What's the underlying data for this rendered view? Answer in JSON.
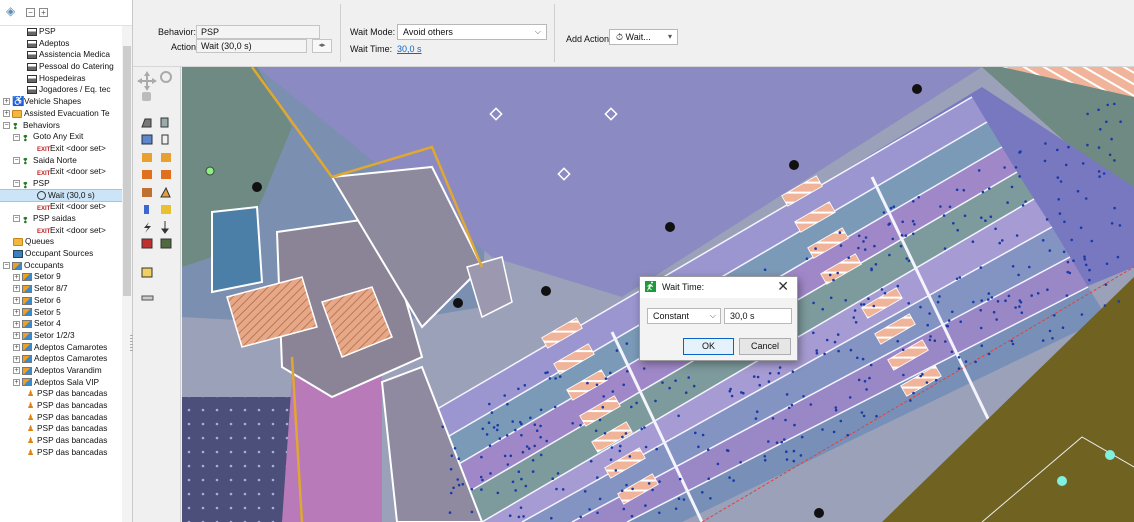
{
  "window": {
    "title": ""
  },
  "tree": {
    "items": [
      {
        "label": "PSP",
        "icon": "profile",
        "indent": 24,
        "exp": ""
      },
      {
        "label": "Adeptos",
        "icon": "profile",
        "indent": 24,
        "exp": ""
      },
      {
        "label": "Assistencia Medica",
        "icon": "profile",
        "indent": 24,
        "exp": ""
      },
      {
        "label": "Pessoal do Catering",
        "icon": "profile",
        "indent": 24,
        "exp": ""
      },
      {
        "label": "Hospedeiras",
        "icon": "profile",
        "indent": 24,
        "exp": ""
      },
      {
        "label": "Jogadores / Eq. tec",
        "icon": "profile",
        "indent": 24,
        "exp": ""
      },
      {
        "label": "Vehicle Shapes",
        "icon": "vehicle",
        "indent": 0,
        "exp": "+"
      },
      {
        "label": "Assisted Evacuation Te",
        "icon": "folder",
        "indent": 0,
        "exp": "+"
      },
      {
        "label": "Behaviors",
        "icon": "behavior",
        "indent": 0,
        "exp": "−"
      },
      {
        "label": "Goto Any Exit",
        "icon": "behavior",
        "indent": 10,
        "exp": "−"
      },
      {
        "label": "Exit <door set>",
        "icon": "exit",
        "indent": 34,
        "exp": ""
      },
      {
        "label": "Saida Norte",
        "icon": "behavior",
        "indent": 10,
        "exp": "−"
      },
      {
        "label": "Exit <door set>",
        "icon": "exit",
        "indent": 34,
        "exp": ""
      },
      {
        "label": "PSP",
        "icon": "behavior",
        "indent": 10,
        "exp": "−"
      },
      {
        "label": "Wait (30,0 s)",
        "icon": "wait",
        "indent": 34,
        "exp": "",
        "selected": true
      },
      {
        "label": "Exit <door set>",
        "icon": "exit",
        "indent": 34,
        "exp": ""
      },
      {
        "label": "PSP saidas",
        "icon": "behavior",
        "indent": 10,
        "exp": "−"
      },
      {
        "label": "Exit <door set>",
        "icon": "exit",
        "indent": 34,
        "exp": ""
      },
      {
        "label": "Queues",
        "icon": "folder",
        "indent": 10,
        "exp": ""
      },
      {
        "label": "Occupant Sources",
        "icon": "source",
        "indent": 10,
        "exp": ""
      },
      {
        "label": "Occupants",
        "icon": "occupant",
        "indent": 0,
        "exp": "−"
      },
      {
        "label": "Setor 9",
        "icon": "occupant",
        "indent": 10,
        "exp": "+"
      },
      {
        "label": "Setor 8/7",
        "icon": "occupant",
        "indent": 10,
        "exp": "+"
      },
      {
        "label": "Setor 6",
        "icon": "occupant",
        "indent": 10,
        "exp": "+"
      },
      {
        "label": "Setor 5",
        "icon": "occupant",
        "indent": 10,
        "exp": "+"
      },
      {
        "label": "Setor 4",
        "icon": "occupant",
        "indent": 10,
        "exp": "+"
      },
      {
        "label": "Setor 1/2/3",
        "icon": "occupant",
        "indent": 10,
        "exp": "+"
      },
      {
        "label": "Adeptos Camarotes",
        "icon": "occupant",
        "indent": 10,
        "exp": "+"
      },
      {
        "label": "Adeptos Camarotes",
        "icon": "occupant",
        "indent": 10,
        "exp": "+"
      },
      {
        "label": "Adeptos Varandim",
        "icon": "occupant",
        "indent": 10,
        "exp": "+"
      },
      {
        "label": "Adeptos Sala VIP",
        "icon": "occupant",
        "indent": 10,
        "exp": "+"
      },
      {
        "label": "PSP das bancadas",
        "icon": "person",
        "indent": 24,
        "exp": ""
      },
      {
        "label": "PSP das bancadas",
        "icon": "person",
        "indent": 24,
        "exp": ""
      },
      {
        "label": "PSP das bancadas",
        "icon": "person",
        "indent": 24,
        "exp": ""
      },
      {
        "label": "PSP das bancadas",
        "icon": "person",
        "indent": 24,
        "exp": ""
      },
      {
        "label": "PSP das bancadas",
        "icon": "person",
        "indent": 24,
        "exp": ""
      },
      {
        "label": "PSP das bancadas",
        "icon": "person",
        "indent": 24,
        "exp": ""
      }
    ]
  },
  "props": {
    "behavior_label": "Behavior:",
    "behavior_value": "PSP",
    "action_label": "Action:",
    "action_value": "Wait (30,0 s)",
    "wait_mode_label": "Wait Mode:",
    "wait_mode_value": "Avoid others",
    "wait_time_label": "Wait Time:",
    "wait_time_value": "30,0 s",
    "add_action_label": "Add Action:",
    "add_action_value": "Wait..."
  },
  "dialog": {
    "title": "Wait Time:",
    "close": "✕",
    "distribution": "Constant",
    "value": "30,0 s",
    "ok": "OK",
    "cancel": "Cancel"
  },
  "colors": {
    "purple_zone": "#8c8ac2",
    "steel_zone": "#7b8fb0",
    "olive_zone": "#706220",
    "green_zone": "#6e8a82",
    "accent_blue": "#1565c0"
  }
}
